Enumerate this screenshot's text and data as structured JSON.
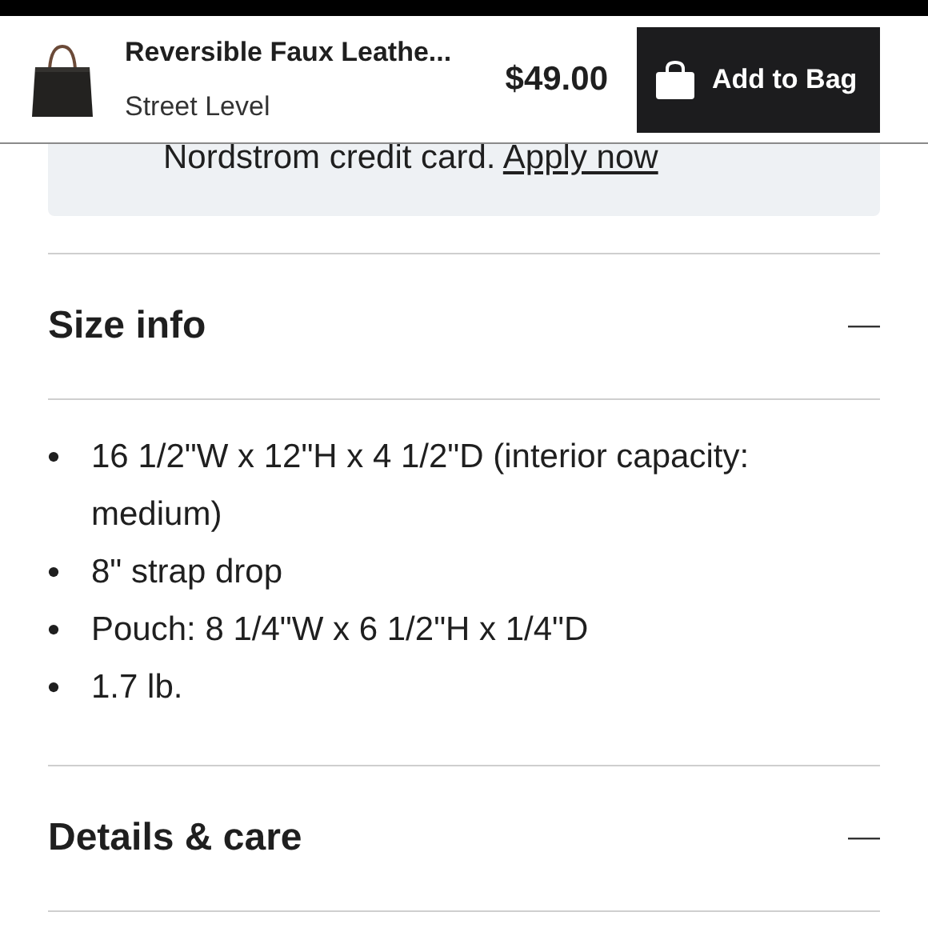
{
  "sticky_bar": {
    "product_name": "Reversible Faux Leathe...",
    "brand": "Street Level",
    "price": "$49.00",
    "button": "Add to Bag"
  },
  "credit_banner": {
    "text": "Nordstrom credit card.",
    "link": "Apply now"
  },
  "sections": [
    {
      "title": "Size info",
      "expanded": true,
      "bullets": [
        "16 1/2\"W x 12\"H x 4 1/2\"D (interior capacity: medium)",
        "8\" strap drop",
        "Pouch: 8 1/4\"W x 6 1/2\"H x 1/4\"D",
        "1.7 lb."
      ]
    },
    {
      "title": "Details & care",
      "expanded": true
    }
  ]
}
